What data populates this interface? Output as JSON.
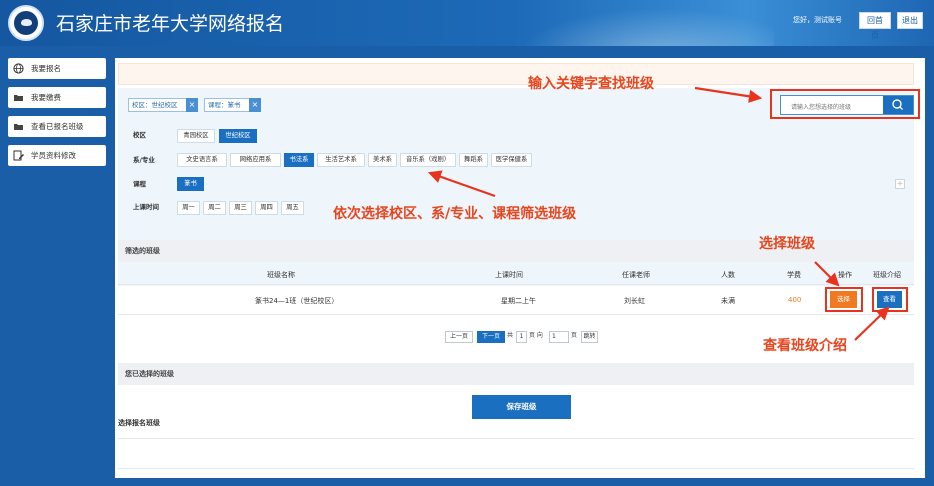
{
  "header": {
    "title": "石家庄市老年大学网络报名",
    "greeting": "您好，测试账号",
    "home": "回首页",
    "logout": "退出"
  },
  "sidebar": {
    "items": [
      {
        "label": "我要报名",
        "icon": "globe-icon"
      },
      {
        "label": "我要缴费",
        "icon": "folder-icon"
      },
      {
        "label": "查看已报名班级",
        "icon": "folder-icon"
      },
      {
        "label": "学员资料修改",
        "icon": "edit-icon"
      }
    ]
  },
  "tags": [
    {
      "label": "校区：世纪校区"
    },
    {
      "label": "课程：篆书"
    }
  ],
  "search": {
    "placeholder": "请输入您想选择的班级",
    "icon": "search-icon"
  },
  "filters": {
    "campus": {
      "label": "校区",
      "options": [
        "青园校区",
        "世纪校区"
      ],
      "selected": "世纪校区"
    },
    "dept": {
      "label": "系/专业",
      "options": [
        "文史语言系",
        "网络应用系",
        "书法系",
        "生活艺术系",
        "美术系",
        "音乐系（戏剧）",
        "舞蹈系",
        "医学保健系"
      ],
      "selected": "书法系"
    },
    "course": {
      "label": "课程",
      "options": [
        "篆书"
      ],
      "selected": "篆书"
    },
    "time": {
      "label": "上课时间",
      "options": [
        "周一",
        "周二",
        "周三",
        "周四",
        "周五"
      ]
    }
  },
  "results": {
    "title": "筛选的班级",
    "headers": [
      "班级名称",
      "上课时间",
      "任课老师",
      "人数",
      "学费",
      "操作",
      "班级介绍"
    ],
    "rows": [
      {
        "name": "篆书24—1班（世纪校区）",
        "time": "星期二上午",
        "teacher": "刘长虹",
        "count": "未满",
        "fee": "400",
        "choose": "选择",
        "view": "查看"
      }
    ]
  },
  "pager": {
    "prev": "上一页",
    "next": "下一页",
    "total_prefix": "共",
    "total": "1",
    "total_suffix": "页 向",
    "goto_value": "1",
    "goto_suffix": "页",
    "jump": "跳转"
  },
  "selected_section": {
    "title": "您已选择的班级"
  },
  "save": "保存班级",
  "enroll_section": {
    "title": "选择报名班级"
  },
  "annotations": {
    "search": "输入关键字查找班级",
    "filter": "依次选择校区、系/专业、课程筛选班级",
    "choose": "选择班级",
    "view": "查看班级介绍"
  },
  "colors": {
    "primary": "#1b6fc0",
    "accent": "#f07a22",
    "annotation": "#e8331e"
  }
}
